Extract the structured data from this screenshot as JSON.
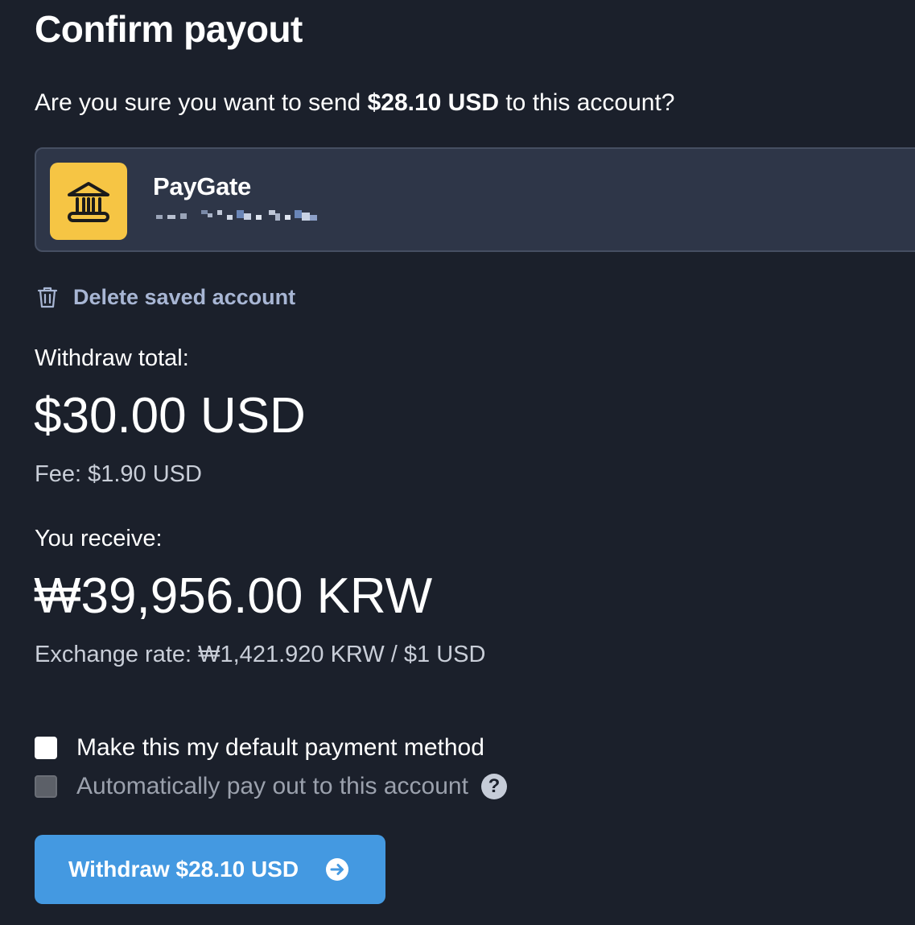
{
  "title": "Confirm payout",
  "confirm": {
    "prefix": "Are you sure you want to send ",
    "amount": "$28.10 USD",
    "suffix": " to this account?"
  },
  "account": {
    "name": "PayGate",
    "masked_number": "",
    "icon": "bank-icon",
    "icon_bg": "#f6c544"
  },
  "delete_label": "Delete saved account",
  "withdraw": {
    "label": "Withdraw total:",
    "amount": "$30.00 USD",
    "fee": "Fee: $1.90 USD"
  },
  "receive": {
    "label": "You receive:",
    "amount": "₩39,956.00 KRW",
    "exchange_rate": "Exchange rate: ₩1,421.920 KRW / $1 USD"
  },
  "options": {
    "default_method": {
      "label": "Make this my default payment method",
      "checked": false,
      "enabled": true
    },
    "auto_payout": {
      "label": "Automatically pay out to this account",
      "checked": false,
      "enabled": false
    }
  },
  "button": {
    "label": "Withdraw $28.10 USD",
    "color": "#4499e1",
    "icon": "arrow-right-circle-icon"
  },
  "colors": {
    "background": "#1b202b",
    "card": "#2e3648",
    "link": "#a8b6d4"
  }
}
